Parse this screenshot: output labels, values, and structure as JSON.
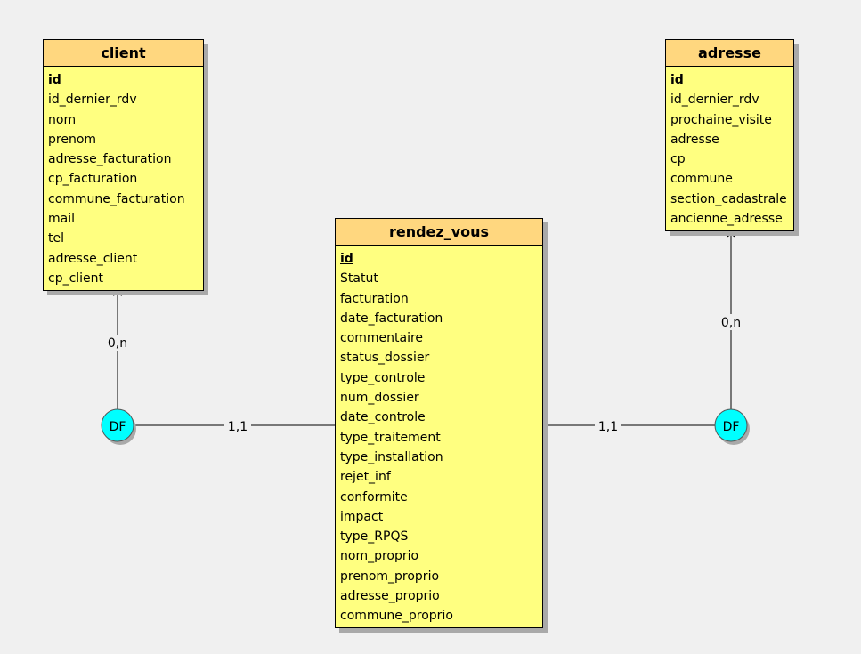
{
  "colors": {
    "background": "#f0f0f0",
    "entity_fill": "#ffff80",
    "entity_header": "#ffd77f",
    "shadow": "#a9a9a9",
    "df_fill": "#00ffff",
    "line": "#000000"
  },
  "entities": {
    "client": {
      "title": "client",
      "attributes": [
        "id",
        "id_dernier_rdv",
        "nom",
        "prenom",
        "adresse_facturation",
        "cp_facturation",
        "commune_facturation",
        "mail",
        "tel",
        "adresse_client",
        "cp_client"
      ]
    },
    "rendez_vous": {
      "title": "rendez_vous",
      "attributes": [
        "id",
        "Statut",
        "facturation",
        "date_facturation",
        "commentaire",
        "status_dossier",
        "type_controle",
        "num_dossier",
        "date_controle",
        "type_traitement",
        "type_installation",
        "rejet_inf",
        "conformite",
        "impact",
        "type_RPQS",
        "nom_proprio",
        "prenom_proprio",
        "adresse_proprio",
        "commune_proprio"
      ]
    },
    "adresse": {
      "title": "adresse",
      "attributes": [
        "id",
        "id_dernier_rdv",
        "prochaine_visite",
        "adresse",
        "cp",
        "commune",
        "section_cadastrale",
        "ancienne_adresse"
      ]
    }
  },
  "relationships": {
    "client_df": {
      "label": "DF",
      "card_entity": "0,n",
      "card_rdv": "1,1"
    },
    "adresse_df": {
      "label": "DF",
      "card_entity": "0,n",
      "card_rdv": "1,1"
    }
  }
}
